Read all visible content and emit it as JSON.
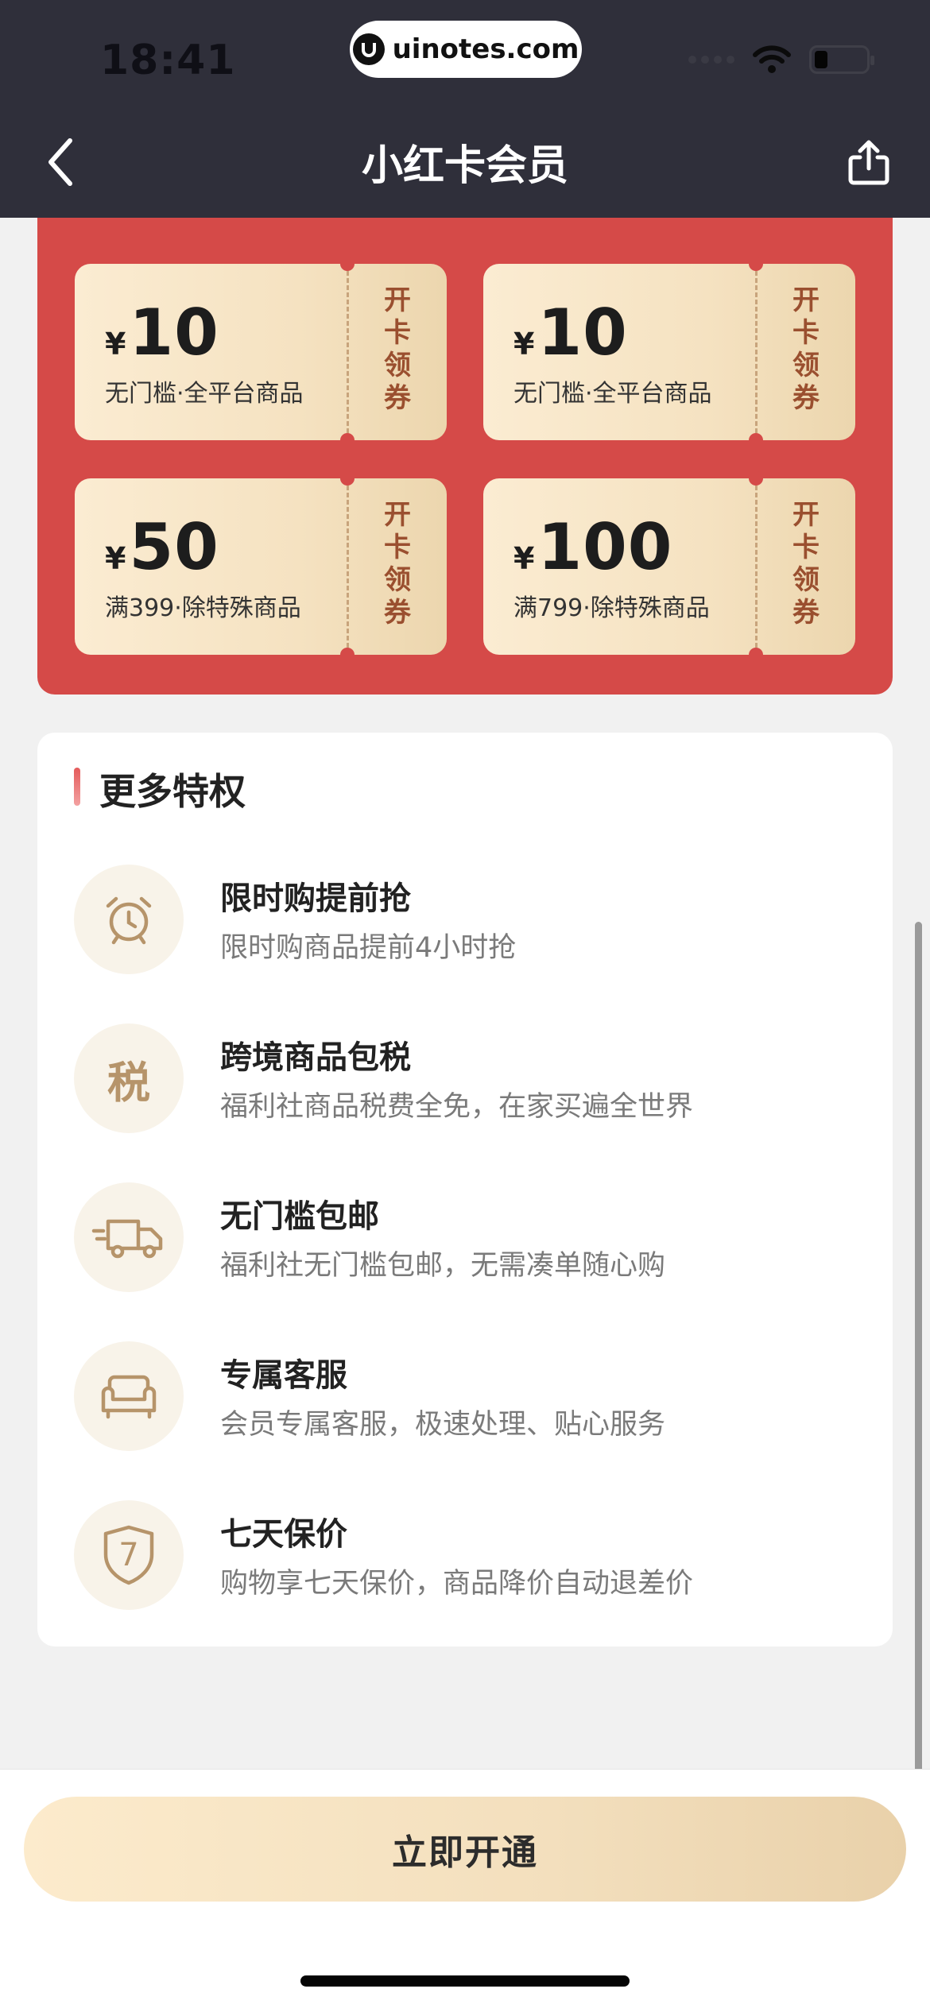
{
  "status_bar": {
    "time": "18:41",
    "url": "uinotes.com"
  },
  "nav": {
    "title": "小红卡会员",
    "back_icon": "chevron-left-icon",
    "share_icon": "share-icon"
  },
  "coupons": [
    {
      "currency": "¥",
      "value": "10",
      "condition": "无门槛·全平台商品",
      "action_chars": [
        "开",
        "卡",
        "领",
        "券"
      ]
    },
    {
      "currency": "¥",
      "value": "10",
      "condition": "无门槛·全平台商品",
      "action_chars": [
        "开",
        "卡",
        "领",
        "券"
      ]
    },
    {
      "currency": "¥",
      "value": "50",
      "condition": "满399·除特殊商品",
      "action_chars": [
        "开",
        "卡",
        "领",
        "券"
      ]
    },
    {
      "currency": "¥",
      "value": "100",
      "condition": "满799·除特殊商品",
      "action_chars": [
        "开",
        "卡",
        "领",
        "券"
      ]
    }
  ],
  "privileges": {
    "title": "更多特权",
    "items": [
      {
        "icon": "alarm-clock-icon",
        "name": "限时购提前抢",
        "desc": "限时购商品提前4小时抢"
      },
      {
        "icon": "tax-icon",
        "icon_glyph": "税",
        "name": "跨境商品包税",
        "desc": "福利社商品税费全免，在家买遍全世界"
      },
      {
        "icon": "delivery-truck-icon",
        "name": "无门槛包邮",
        "desc": "福利社无门槛包邮，无需凑单随心购"
      },
      {
        "icon": "sofa-icon",
        "name": "专属客服",
        "desc": "会员专属客服，极速处理、贴心服务"
      },
      {
        "icon": "shield-seven-icon",
        "icon_glyph": "7",
        "name": "七天保价",
        "desc": "购物享七天保价，商品降价自动退差价"
      }
    ]
  },
  "cta": {
    "label": "立即开通"
  },
  "colors": {
    "header_bg": "#2f2f3a",
    "red_panel": "#d54a48",
    "coupon_gold": "#f5e2c1",
    "icon_gold": "#b6946a"
  }
}
